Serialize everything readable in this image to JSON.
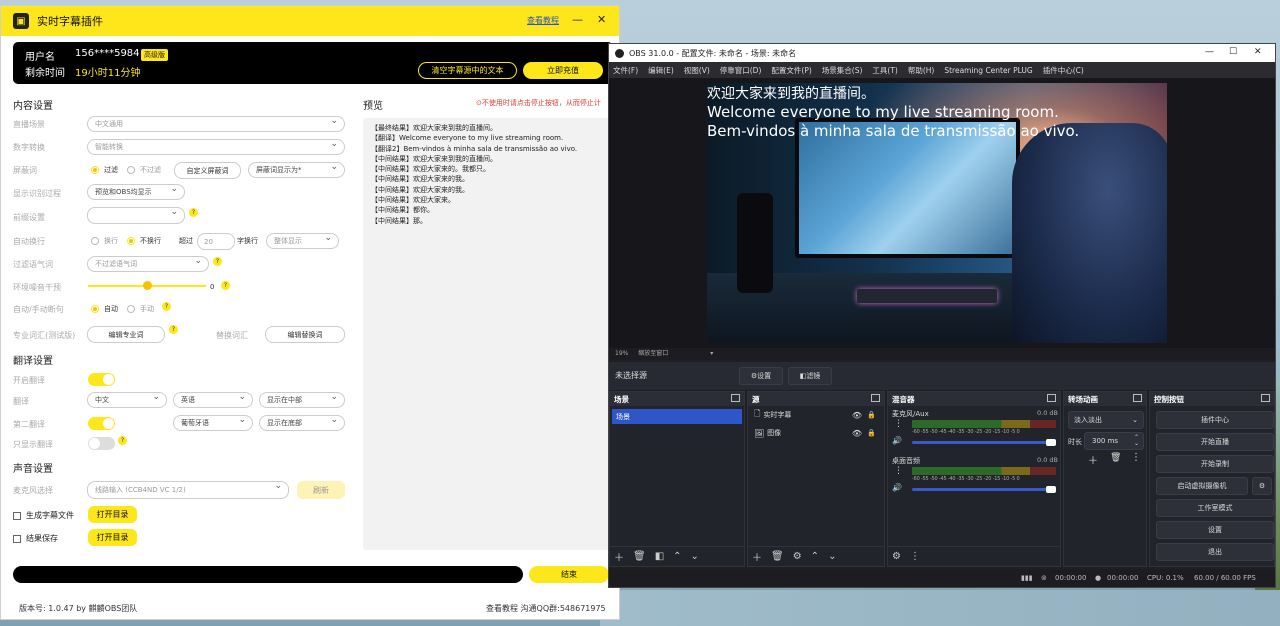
{
  "plugin": {
    "title": "实时字幕插件",
    "help_link": "查看教程",
    "account": {
      "username_label": "用户名",
      "username": "156****5984",
      "badge": "高级版",
      "time_label": "剩余时间",
      "time_value": "19小时11分钟",
      "clear_button": "清空字幕源中的文本",
      "recharge_button": "立即充值"
    },
    "content_settings": {
      "title": "内容设置",
      "scene_label": "直播场景",
      "scene_value": "中文通用",
      "digit_label": "数字转换",
      "digit_value": "智能转换",
      "block_label": "屏蔽词",
      "block_filter": "过滤",
      "block_nofilter": "不过滤",
      "block_custom_button": "自定义屏蔽词",
      "block_display": "屏蔽词显示为*",
      "show_process_label": "显示识别过程",
      "show_process_value": "预览和OBS均显示",
      "prefix_label": "前缀设置",
      "autowrap_label": "自动换行",
      "wrap_on": "换行",
      "wrap_off": "不换行",
      "over_label": "超过",
      "over_value": "20",
      "chars_wrap_label": "字换行",
      "whole_display": "整体显示",
      "filter_tone_label": "过滤语气词",
      "filter_tone_value": "不过滤语气词",
      "noise_label": "环境噪音干预",
      "noise_value": "0",
      "sentence_label": "自动/手动断句",
      "sentence_auto": "自动",
      "sentence_manual": "手动",
      "terms_label": "专业词汇(测试版)",
      "terms_button": "编辑专业词",
      "replace_label": "替换词汇",
      "replace_button": "编辑替换词"
    },
    "translate_settings": {
      "title": "翻译设置",
      "enable_label": "开启翻译",
      "translate_label": "翻译",
      "from_lang": "中文",
      "to_lang": "英语",
      "position1": "显示在中部",
      "second_label": "第二翻译",
      "second_lang": "葡萄牙语",
      "position2": "显示在底部",
      "only_label": "只显示翻译"
    },
    "audio_settings": {
      "title": "声音设置",
      "mic_label": "麦克风选择",
      "mic_value": "线路输入 (CCB4ND VC 1/2)",
      "refresh_button": "刷新",
      "gen_file_label": "生成字幕文件",
      "open_dir1": "打开目录",
      "save_result_label": "结果保存",
      "open_dir2": "打开目录"
    },
    "preview": {
      "title": "预览",
      "warning": "⊙不使用时请点击停止按钮，从而停止计",
      "lines": [
        "【最终结果】欢迎大家来到我的直播间。",
        "【翻译】Welcome everyone to my live streaming room.",
        "【翻译2】Bem-vindos à minha sala de transmissão ao vivo.",
        "【中间结果】欢迎大家来到我的直播间。",
        "【中间结果】欢迎大家来的。我都只。",
        "【中间结果】欢迎大家来的我。",
        "【中间结果】欢迎大家来的我。",
        "【中间结果】欢迎大家来。",
        "【中间结果】都你。",
        "【中间结果】那。"
      ]
    },
    "end_button": "结束",
    "version": "版本号: 1.0.47 by 麒麟OBS团队",
    "footer_right": "查看教程  沟通QQ群:548671975"
  },
  "obs": {
    "title": "OBS 31.0.0 - 配置文件: 未命名 - 场景: 未命名",
    "menu": [
      "文件(F)",
      "编辑(E)",
      "视图(V)",
      "停靠窗口(D)",
      "配置文件(P)",
      "场景集合(S)",
      "工具(T)",
      "帮助(H)",
      "Streaming Center PLUG",
      "插件中心(C)"
    ],
    "captions": [
      "欢迎大家来到我的直播间。",
      "Welcome everyone to my live streaming room.",
      "Bem-vindos à minha sala de transmissão ao vivo."
    ],
    "zoom": "19%",
    "zoom_label": "缩放至窗口",
    "no_source": "未选择源",
    "settings_button": "设置",
    "filters_button": "滤镜",
    "docks": {
      "scenes_title": "场景",
      "scene_item": "场景",
      "sources_title": "源",
      "sources": [
        {
          "name": "实时字幕",
          "icon": "text-icon"
        },
        {
          "name": "图像",
          "icon": "image-icon"
        }
      ],
      "mixer_title": "混音器",
      "mic_name": "麦克风/Aux",
      "mic_db": "0.0 dB",
      "desktop_name": "桌面音频",
      "desktop_db": "0.0 dB",
      "meter_ticks": "-60 -55 -50 -45 -40 -35 -30 -25 -20 -15 -10 -5 0",
      "transitions_title": "转场动画",
      "transition_value": "淡入淡出",
      "duration_label": "时长",
      "duration_value": "300 ms",
      "controls_title": "控制按钮",
      "controls": [
        "插件中心",
        "开始直播",
        "开始录制",
        "启动虚拟摄像机",
        "工作室模式",
        "设置",
        "退出"
      ]
    },
    "status": {
      "time1": "00:00:00",
      "time2": "00:00:00",
      "cpu": "CPU: 0.1%",
      "fps": "60.00 / 60.00 FPS"
    }
  },
  "colors": {
    "accent": "#fde619",
    "obs_select": "#2f56c8",
    "warning": "#e53935"
  }
}
